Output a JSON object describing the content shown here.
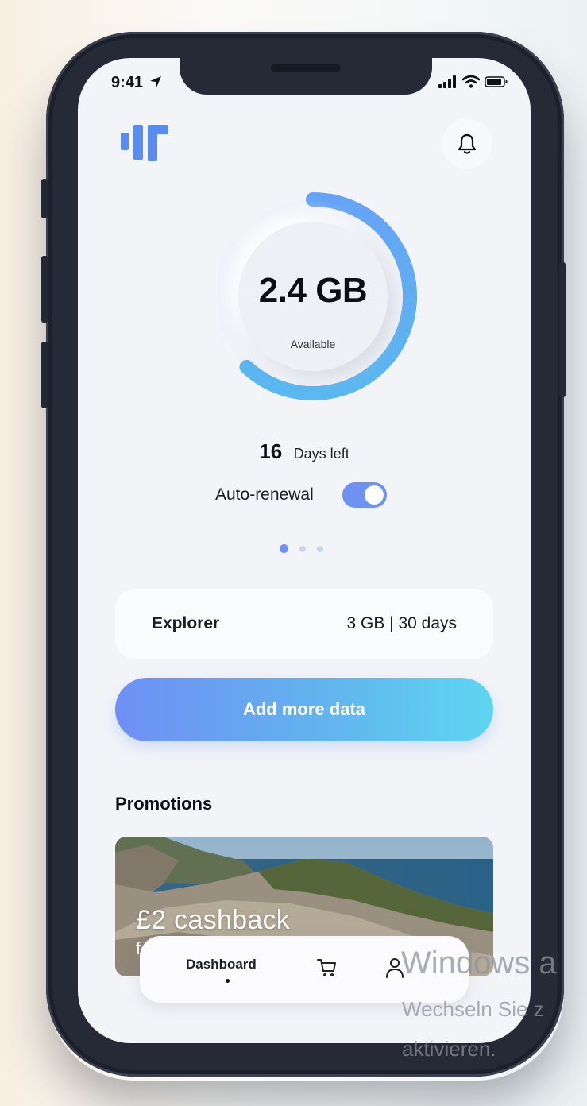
{
  "status_bar": {
    "time": "9:41"
  },
  "usage": {
    "amount": "2.4 GB",
    "label": "Available",
    "progress_fraction": 0.62,
    "days_count": "16",
    "days_label": "Days left"
  },
  "auto_renewal": {
    "label": "Auto-renewal",
    "enabled": true
  },
  "pager": {
    "count": 3,
    "active": 0
  },
  "plan": {
    "name": "Explorer",
    "info": "3 GB | 30 days"
  },
  "cta": {
    "label": "Add more data"
  },
  "promotions": {
    "title": "Promotions",
    "card_title": "£2 cashback",
    "card_sub": "f"
  },
  "bottom_nav": {
    "dashboard_label": "Dashboard"
  },
  "watermark": {
    "line1": "Windows a",
    "line2": "Wechseln Sie z",
    "line3": "aktivieren."
  },
  "colors": {
    "accent": "#6e92f2",
    "gauge_start": "#5ab4f0",
    "gauge_end": "#66a3f4"
  }
}
